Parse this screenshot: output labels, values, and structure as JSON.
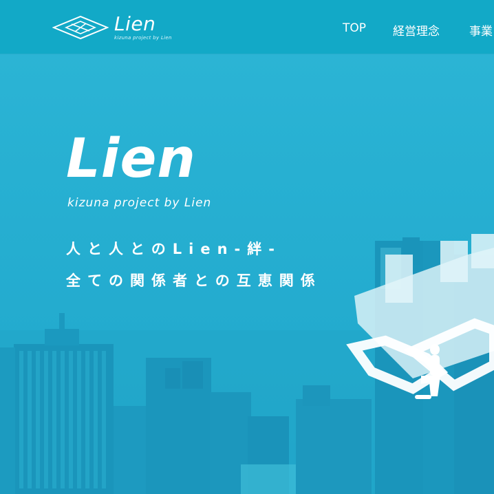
{
  "brand": {
    "name": "Lien",
    "tagline_small": "kizuna project by Lien"
  },
  "nav": {
    "items": [
      {
        "label": "TOP"
      },
      {
        "label": "経営理念"
      },
      {
        "label": "事業"
      }
    ]
  },
  "hero": {
    "title": "Lien",
    "subtitle": "kizuna project by Lien",
    "line1": "人と人とのLien-絆-",
    "line2": "全ての関係者との互恵関係"
  },
  "colors": {
    "primary": "#12a9c7",
    "hero_bg": "#27b0d2",
    "text": "#ffffff"
  }
}
